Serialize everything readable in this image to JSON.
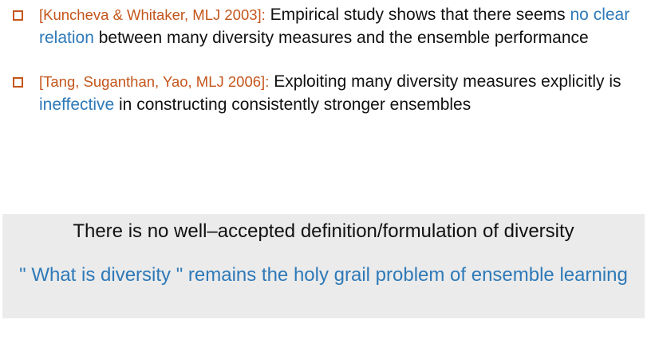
{
  "bullets": [
    {
      "citation": "[Kuncheva & Whitaker, MLJ 2003]:",
      "text_before": "Empirical study shows that there seems",
      "emphasis": "no clear relation",
      "text_after": "between many diversity measures and the ensemble performance"
    },
    {
      "citation": "[Tang, Suganthan, Yao, MLJ 2006]:",
      "text_before": "Exploiting many diversity measures explicitly is",
      "emphasis": "ineffective",
      "text_after": "in constructing consistently stronger ensembles"
    }
  ],
  "summary": {
    "statement": "There is no well–accepted definition/formulation of diversity",
    "question": "\" What is diversity \" remains the holy grail problem of ensemble learning"
  },
  "colors": {
    "citation": "#c4561c",
    "emphasis": "#2e79b8",
    "summary_background": "#ebebeb",
    "bullet_marker": "#c4561c"
  },
  "icons": {
    "bullet": "hollow-square-bullet-icon"
  }
}
